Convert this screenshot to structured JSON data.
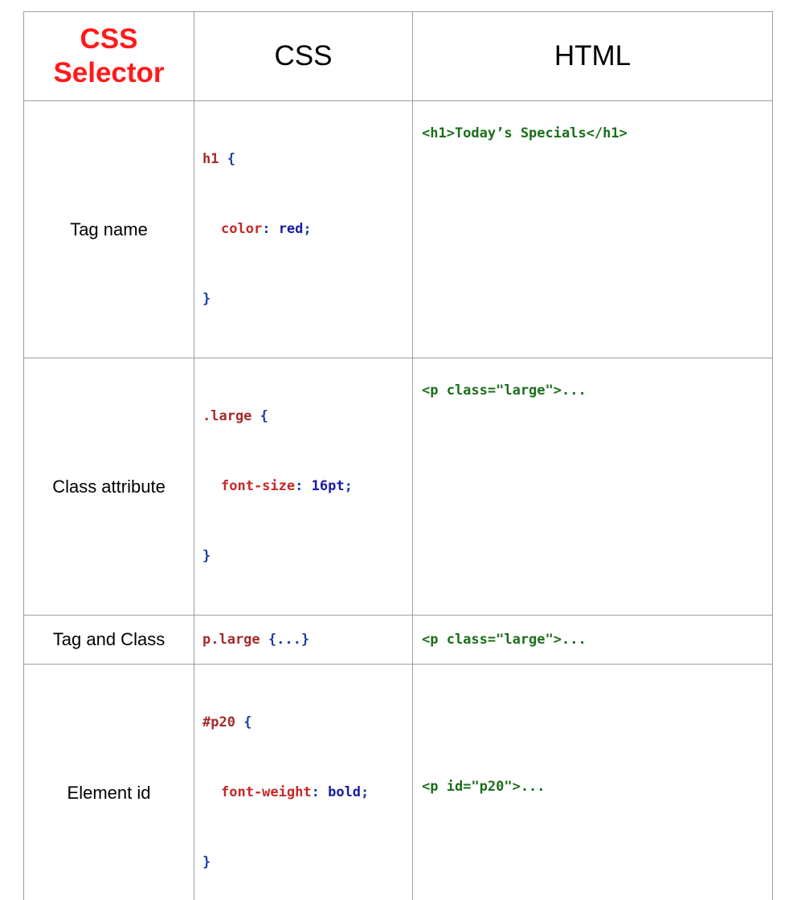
{
  "header": {
    "col1_line1": "CSS",
    "col1_line2": "Selector",
    "col2": "CSS",
    "col3": "HTML"
  },
  "rows": [
    {
      "label": "Tag name",
      "css": {
        "selector": "h1",
        "open": "{",
        "property": "color",
        "value": "red",
        "close": "}"
      },
      "html": "<h1>Today’s Specials</h1>"
    },
    {
      "label": "Class attribute",
      "css": {
        "selector": ".large",
        "open": "{",
        "property": "font-size",
        "value": "16pt",
        "close": "}"
      },
      "html": "<p class=\"large\">..."
    },
    {
      "label": "Tag and Class",
      "css": {
        "selector": "p.large",
        "rest": "{...}"
      },
      "html": "<p class=\"large\">..."
    },
    {
      "label": "Element id",
      "css": {
        "selector": "#p20",
        "open": "{",
        "property": "font-weight",
        "value": "bold",
        "close": "}"
      },
      "html": "<p id=\"p20\">..."
    }
  ],
  "colors": {
    "selector_header": "#ff1a1a",
    "selector_code": "#a52a2a",
    "brace": "#1a3ea5",
    "property": "#c62828",
    "value": "#1a1aa5",
    "html": "#1b6e1b",
    "border": "#9e9e9e"
  }
}
